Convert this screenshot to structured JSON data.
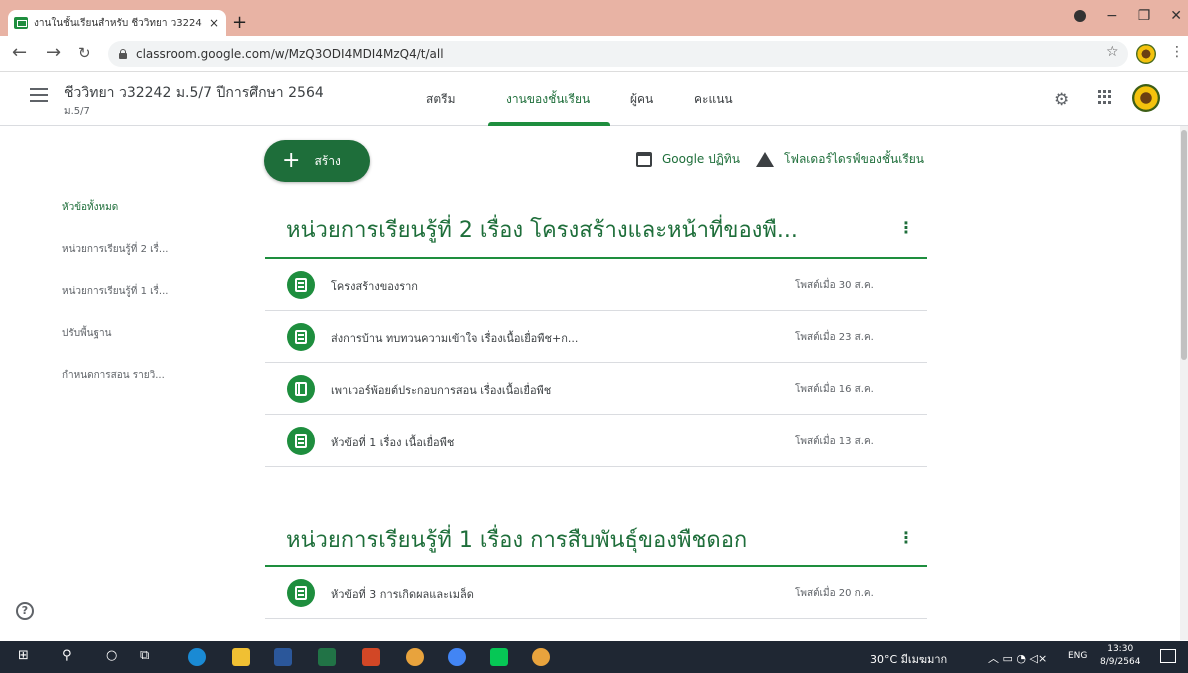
{
  "browser": {
    "tab_title": "งานในชั้นเรียนสำหรับ ชีววิทยา ว3224",
    "tab_close": "×",
    "new_tab": "+",
    "url": "classroom.google.com/w/MzQ3ODI4MDI4MzQ4/t/all"
  },
  "header": {
    "class_title": "ชีววิทยา ว32242 ม.5/7 ปีการศึกษา 2564",
    "class_section": "ม.5/7",
    "tabs": [
      {
        "label": "สตรีม"
      },
      {
        "label": "งานของชั้นเรียน",
        "active": true
      },
      {
        "label": "ผู้คน"
      },
      {
        "label": "คะแนน"
      }
    ]
  },
  "toolbar": {
    "create_label": "สร้าง",
    "calendar_label": "Google ปฏิทิน",
    "drive_label": "โฟลเดอร์ไดรฟ์ของชั้นเรียน"
  },
  "sidebar": {
    "items": [
      {
        "label": "หัวข้อทั้งหมด",
        "active": true
      },
      {
        "label": "หน่วยการเรียนรู้ที่ 2 เรื่..."
      },
      {
        "label": "หน่วยการเรียนรู้ที่ 1 เรื่..."
      },
      {
        "label": "ปรับพื้นฐาน"
      },
      {
        "label": "กำหนดการสอน รายวิ..."
      }
    ]
  },
  "topics": [
    {
      "title": "หน่วยการเรียนรู้ที่ 2 เรื่อง โครงสร้างและหน้าที่ของพื...",
      "items": [
        {
          "icon": "assignment-icon",
          "title": "โครงสร้างของราก",
          "date": "โพสต์เมื่อ 30 ส.ค."
        },
        {
          "icon": "assignment-icon",
          "title": "ส่งการบ้าน ทบทวนความเข้าใจ เรื่องเนื้อเยื่อพืช+ก...",
          "date": "โพสต์เมื่อ 23 ส.ค."
        },
        {
          "icon": "material-icon",
          "title": "เพาเวอร์พ้อยต์ประกอบการสอน เรื่องเนื้อเยื่อพืช",
          "date": "โพสต์เมื่อ 16 ส.ค."
        },
        {
          "icon": "assignment-icon",
          "title": "หัวข้อที่ 1 เรื่อง เนื้อเยื่อพืช",
          "date": "โพสต์เมื่อ 13 ส.ค."
        }
      ]
    },
    {
      "title": "หน่วยการเรียนรู้ที่ 1 เรื่อง การสืบพันธุ์ของพืชดอก",
      "items": [
        {
          "icon": "assignment-icon",
          "title": "หัวข้อที่ 3 การเกิดผลและเมล็ด",
          "date": "โพสต์เมื่อ 20 ก.ค."
        }
      ]
    }
  ],
  "taskbar": {
    "weather": "30°C มีเมฆมาก",
    "lang": "ENG",
    "time": "13:30",
    "date": "8/9/2564"
  },
  "colors": {
    "accent": "#1e8e3e",
    "accent_dark": "#1e6e3a",
    "tabstrip": "#e8b3a4",
    "taskbar": "#1f2733"
  }
}
